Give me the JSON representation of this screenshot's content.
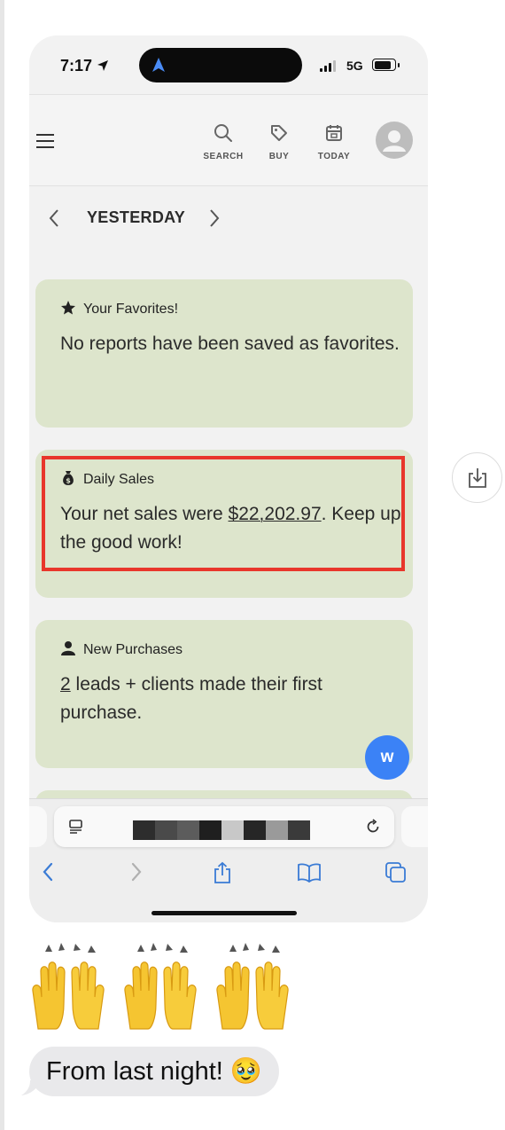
{
  "status_bar": {
    "time": "7:17",
    "network": "5G"
  },
  "app_header": {
    "nav": [
      {
        "label": "SEARCH",
        "icon": "search-icon"
      },
      {
        "label": "BUY",
        "icon": "tag-icon"
      },
      {
        "label": "TODAY",
        "icon": "calendar-icon"
      }
    ]
  },
  "date_nav": {
    "label": "YESTERDAY"
  },
  "cards": {
    "favorites": {
      "title": "Your Favorites!",
      "body": "No reports have been saved as favorites."
    },
    "daily_sales": {
      "title": "Daily Sales",
      "body_prefix": "Your net sales were ",
      "amount": "$22,202.97",
      "body_suffix": ". Keep up the good work!"
    },
    "new_purchases": {
      "title": "New Purchases",
      "count": "2",
      "body_suffix": " leads + clients made their first purchase."
    }
  },
  "fab": {
    "label": "w"
  },
  "message": {
    "text": "From last night! 🥹"
  },
  "colors": {
    "card_bg": "#dde5cc",
    "highlight": "#e8362b",
    "fab": "#3b82f6",
    "ios_blue": "#3a7bd5"
  }
}
